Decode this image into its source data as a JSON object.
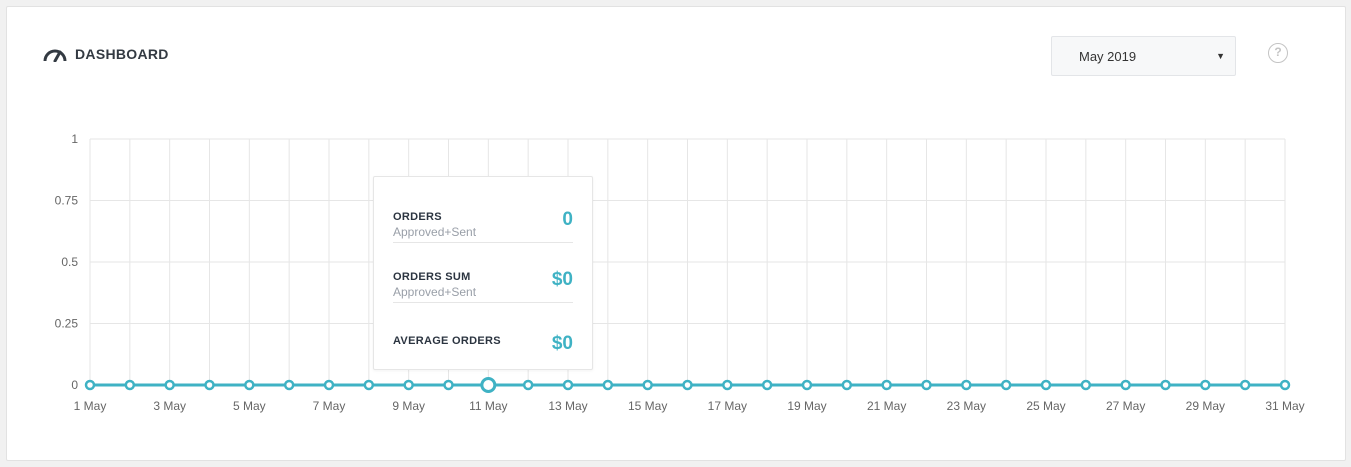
{
  "header": {
    "title": "DASHBOARD",
    "icon": "speedometer-icon",
    "month_selected": "May 2019",
    "help_label": "?"
  },
  "tooltip": {
    "rows": [
      {
        "label": "ORDERS",
        "sub": "Approved+Sent",
        "value": "0"
      },
      {
        "label": "ORDERS SUM",
        "sub": "Approved+Sent",
        "value": "$0"
      },
      {
        "label": "AVERAGE ORDERS",
        "sub": "",
        "value": "$0"
      }
    ]
  },
  "colors": {
    "line": "#3fb2c4",
    "accent": "#3fb2c4",
    "grid": "#e6e6e6"
  },
  "chart_data": {
    "type": "line",
    "x": [
      "1 May",
      "2 May",
      "3 May",
      "4 May",
      "5 May",
      "6 May",
      "7 May",
      "8 May",
      "9 May",
      "10 May",
      "11 May",
      "12 May",
      "13 May",
      "14 May",
      "15 May",
      "16 May",
      "17 May",
      "18 May",
      "19 May",
      "20 May",
      "21 May",
      "22 May",
      "23 May",
      "24 May",
      "25 May",
      "26 May",
      "27 May",
      "28 May",
      "29 May",
      "30 May",
      "31 May"
    ],
    "tick_labels": [
      "1 May",
      "3 May",
      "5 May",
      "7 May",
      "9 May",
      "11 May",
      "13 May",
      "15 May",
      "17 May",
      "19 May",
      "21 May",
      "23 May",
      "25 May",
      "27 May",
      "29 May",
      "31 May"
    ],
    "values": [
      0,
      0,
      0,
      0,
      0,
      0,
      0,
      0,
      0,
      0,
      0,
      0,
      0,
      0,
      0,
      0,
      0,
      0,
      0,
      0,
      0,
      0,
      0,
      0,
      0,
      0,
      0,
      0,
      0,
      0,
      0
    ],
    "ylim": [
      0,
      1
    ],
    "yticks": [
      "1",
      "0.75",
      "0.5",
      "0.25",
      "0"
    ],
    "highlighted_index": 10,
    "grid": true
  }
}
